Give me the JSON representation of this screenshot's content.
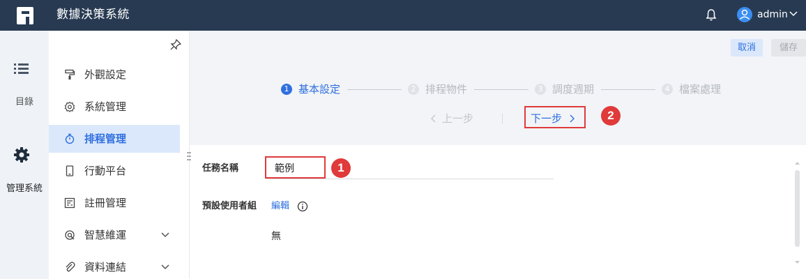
{
  "app": {
    "title": "數據決策系統",
    "user": "admin",
    "accent": "#2f6fe0",
    "header_bg": "#283a52"
  },
  "rail": {
    "items": [
      {
        "label": "目錄",
        "icon": "list-icon"
      },
      {
        "label": "管理系統",
        "icon": "gear-icon"
      }
    ]
  },
  "menu": {
    "items": [
      {
        "label": "外觀設定",
        "icon": "paint-roller-icon"
      },
      {
        "label": "系統管理",
        "icon": "gear-icon"
      },
      {
        "label": "排程管理",
        "icon": "timer-icon",
        "active": true
      },
      {
        "label": "行動平台",
        "icon": "mobile-icon"
      },
      {
        "label": "註冊管理",
        "icon": "register-icon"
      },
      {
        "label": "智慧維運",
        "icon": "smart-ops-icon",
        "expandable": true
      },
      {
        "label": "資料連結",
        "icon": "paperclip-icon",
        "expandable": true
      }
    ]
  },
  "toolbar": {
    "cancel": "取消",
    "save": "儲存"
  },
  "steps": [
    {
      "num": "1",
      "label": "基本設定",
      "active": true
    },
    {
      "num": "2",
      "label": "排程物件",
      "active": false
    },
    {
      "num": "3",
      "label": "調度週期",
      "active": false
    },
    {
      "num": "4",
      "label": "檔案處理",
      "active": false
    }
  ],
  "nav": {
    "prev": "上一步",
    "next": "下一步"
  },
  "form": {
    "task_name_label": "任務名稱",
    "task_name_value": "範例",
    "default_group_label": "預設使用者組",
    "edit_link": "編輯",
    "default_group_value": "無"
  },
  "callouts": {
    "first": "1",
    "second": "2"
  }
}
